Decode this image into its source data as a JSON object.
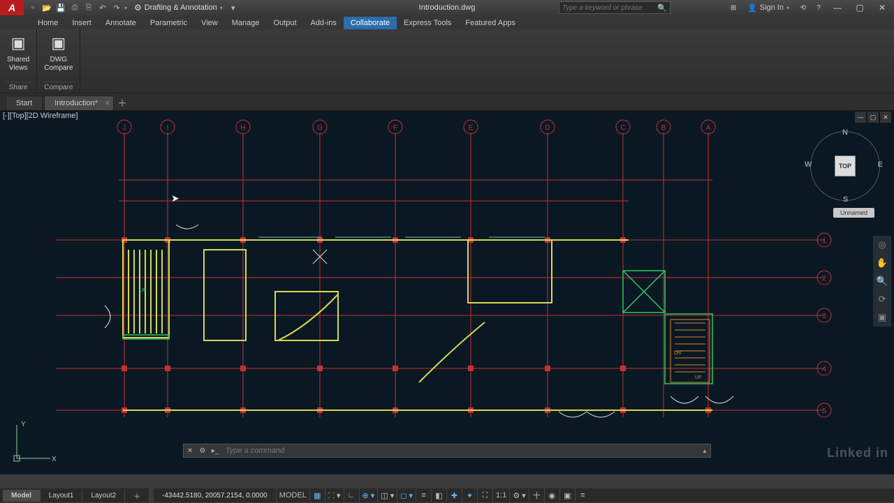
{
  "app": {
    "title": "Introduction.dwg",
    "workspace": "Drafting & Annotation"
  },
  "search": {
    "placeholder": "Type a keyword or phrase"
  },
  "signin": {
    "label": "Sign In"
  },
  "ribbon": {
    "tabs": [
      "Home",
      "Insert",
      "Annotate",
      "Parametric",
      "View",
      "Manage",
      "Output",
      "Add-ins",
      "Collaborate",
      "Express Tools",
      "Featured Apps"
    ],
    "active_index": 8,
    "panels": [
      {
        "button": {
          "line1": "Shared",
          "line2": "Views"
        },
        "label": "Share"
      },
      {
        "button": {
          "line1": "DWG",
          "line2": "Compare"
        },
        "label": "Compare"
      }
    ]
  },
  "file_tabs": {
    "items": [
      {
        "label": "Start"
      },
      {
        "label": "Introduction*"
      }
    ],
    "active_index": 1
  },
  "viewport": {
    "label": "[-][Top][2D Wireframe]"
  },
  "viewcube": {
    "face": "TOP",
    "n": "N",
    "s": "S",
    "e": "E",
    "w": "W",
    "unnamed": "Unnamed"
  },
  "grid_bubbles": [
    "J",
    "I",
    "H",
    "G",
    "F",
    "E",
    "D",
    "C",
    "B",
    "A"
  ],
  "grid_bubbles_v": [
    "1",
    "2",
    "3",
    "4",
    "5"
  ],
  "stair_labels": {
    "up": "UP",
    "dn": "DN"
  },
  "command": {
    "placeholder": "Type a command"
  },
  "layout_tabs": {
    "items": [
      "Model",
      "Layout1",
      "Layout2"
    ],
    "active_index": 0
  },
  "status": {
    "coords": "-43442.5180, 20057.2154, 0.0000",
    "space": "MODEL",
    "annoscale": "1:1"
  },
  "watermark": "Linked in",
  "ucs": {
    "x": "X",
    "y": "Y"
  }
}
